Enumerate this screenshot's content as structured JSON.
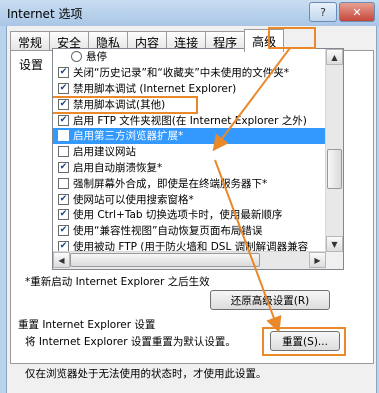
{
  "window": {
    "title": "Internet 选项",
    "help_glyph": "?",
    "close_glyph": "✕"
  },
  "tabs": [
    {
      "label": "常规"
    },
    {
      "label": "安全"
    },
    {
      "label": "隐私"
    },
    {
      "label": "内容"
    },
    {
      "label": "连接"
    },
    {
      "label": "程序"
    },
    {
      "label": "高级",
      "active": true
    }
  ],
  "settings": {
    "group_label": "设置",
    "items": [
      {
        "type": "radio",
        "checked": false,
        "label": "悬停"
      },
      {
        "type": "checkbox",
        "checked": true,
        "label": "关闭“历史记录”和“收藏夹”中未使用的文件夹*"
      },
      {
        "type": "checkbox",
        "checked": true,
        "label": "禁用脚本调试 (Internet Explorer)"
      },
      {
        "type": "checkbox",
        "checked": true,
        "label": "禁用脚本调试(其他)"
      },
      {
        "type": "checkbox",
        "checked": true,
        "label": "启用 FTP 文件夹视图(在 Internet Explorer 之外)"
      },
      {
        "type": "checkbox",
        "checked": false,
        "label": "启用第三方浏览器扩展*",
        "selected": true
      },
      {
        "type": "checkbox",
        "checked": false,
        "label": "启用建议网站"
      },
      {
        "type": "checkbox",
        "checked": true,
        "label": "启用自动崩溃恢复*"
      },
      {
        "type": "checkbox",
        "checked": false,
        "label": "强制屏幕外合成，即使是在终端服务器下*"
      },
      {
        "type": "checkbox",
        "checked": true,
        "label": "使网站可以使用搜索窗格*"
      },
      {
        "type": "checkbox",
        "checked": true,
        "label": "使用 Ctrl+Tab 切换选项卡时，使用最新顺序"
      },
      {
        "type": "checkbox",
        "checked": true,
        "label": "使用“兼容性视图”自动恢复页面布局错误"
      },
      {
        "type": "checkbox",
        "checked": true,
        "label": "使用被动 FTP (用于防火墙和 DSL 调制解调器兼容"
      }
    ],
    "scroll_up_glyph": "▲",
    "scroll_down_glyph": "▼",
    "scroll_left_glyph": "◀",
    "scroll_right_glyph": "▶"
  },
  "restart_note": "*重新启动 Internet Explorer 之后生效",
  "restore_button": "还原高级设置(R)",
  "reset": {
    "title": "重置 Internet Explorer 设置",
    "description": "将 Internet Explorer 设置重置为默认设置。",
    "button": "重置(S)...",
    "note": "仅在浏览器处于无法使用的状态时，才使用此设置。"
  },
  "colors": {
    "highlight_outline": "#e9892a",
    "selection": "#3399ff"
  }
}
